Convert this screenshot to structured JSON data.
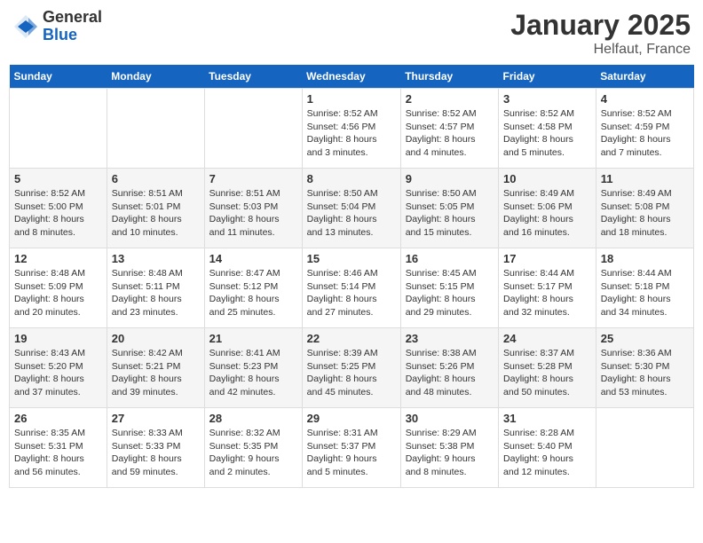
{
  "logo": {
    "general": "General",
    "blue": "Blue"
  },
  "title": "January 2025",
  "subtitle": "Helfaut, France",
  "weekdays": [
    "Sunday",
    "Monday",
    "Tuesday",
    "Wednesday",
    "Thursday",
    "Friday",
    "Saturday"
  ],
  "weeks": [
    [
      {
        "day": "",
        "info": ""
      },
      {
        "day": "",
        "info": ""
      },
      {
        "day": "",
        "info": ""
      },
      {
        "day": "1",
        "info": "Sunrise: 8:52 AM\nSunset: 4:56 PM\nDaylight: 8 hours\nand 3 minutes."
      },
      {
        "day": "2",
        "info": "Sunrise: 8:52 AM\nSunset: 4:57 PM\nDaylight: 8 hours\nand 4 minutes."
      },
      {
        "day": "3",
        "info": "Sunrise: 8:52 AM\nSunset: 4:58 PM\nDaylight: 8 hours\nand 5 minutes."
      },
      {
        "day": "4",
        "info": "Sunrise: 8:52 AM\nSunset: 4:59 PM\nDaylight: 8 hours\nand 7 minutes."
      }
    ],
    [
      {
        "day": "5",
        "info": "Sunrise: 8:52 AM\nSunset: 5:00 PM\nDaylight: 8 hours\nand 8 minutes."
      },
      {
        "day": "6",
        "info": "Sunrise: 8:51 AM\nSunset: 5:01 PM\nDaylight: 8 hours\nand 10 minutes."
      },
      {
        "day": "7",
        "info": "Sunrise: 8:51 AM\nSunset: 5:03 PM\nDaylight: 8 hours\nand 11 minutes."
      },
      {
        "day": "8",
        "info": "Sunrise: 8:50 AM\nSunset: 5:04 PM\nDaylight: 8 hours\nand 13 minutes."
      },
      {
        "day": "9",
        "info": "Sunrise: 8:50 AM\nSunset: 5:05 PM\nDaylight: 8 hours\nand 15 minutes."
      },
      {
        "day": "10",
        "info": "Sunrise: 8:49 AM\nSunset: 5:06 PM\nDaylight: 8 hours\nand 16 minutes."
      },
      {
        "day": "11",
        "info": "Sunrise: 8:49 AM\nSunset: 5:08 PM\nDaylight: 8 hours\nand 18 minutes."
      }
    ],
    [
      {
        "day": "12",
        "info": "Sunrise: 8:48 AM\nSunset: 5:09 PM\nDaylight: 8 hours\nand 20 minutes."
      },
      {
        "day": "13",
        "info": "Sunrise: 8:48 AM\nSunset: 5:11 PM\nDaylight: 8 hours\nand 23 minutes."
      },
      {
        "day": "14",
        "info": "Sunrise: 8:47 AM\nSunset: 5:12 PM\nDaylight: 8 hours\nand 25 minutes."
      },
      {
        "day": "15",
        "info": "Sunrise: 8:46 AM\nSunset: 5:14 PM\nDaylight: 8 hours\nand 27 minutes."
      },
      {
        "day": "16",
        "info": "Sunrise: 8:45 AM\nSunset: 5:15 PM\nDaylight: 8 hours\nand 29 minutes."
      },
      {
        "day": "17",
        "info": "Sunrise: 8:44 AM\nSunset: 5:17 PM\nDaylight: 8 hours\nand 32 minutes."
      },
      {
        "day": "18",
        "info": "Sunrise: 8:44 AM\nSunset: 5:18 PM\nDaylight: 8 hours\nand 34 minutes."
      }
    ],
    [
      {
        "day": "19",
        "info": "Sunrise: 8:43 AM\nSunset: 5:20 PM\nDaylight: 8 hours\nand 37 minutes."
      },
      {
        "day": "20",
        "info": "Sunrise: 8:42 AM\nSunset: 5:21 PM\nDaylight: 8 hours\nand 39 minutes."
      },
      {
        "day": "21",
        "info": "Sunrise: 8:41 AM\nSunset: 5:23 PM\nDaylight: 8 hours\nand 42 minutes."
      },
      {
        "day": "22",
        "info": "Sunrise: 8:39 AM\nSunset: 5:25 PM\nDaylight: 8 hours\nand 45 minutes."
      },
      {
        "day": "23",
        "info": "Sunrise: 8:38 AM\nSunset: 5:26 PM\nDaylight: 8 hours\nand 48 minutes."
      },
      {
        "day": "24",
        "info": "Sunrise: 8:37 AM\nSunset: 5:28 PM\nDaylight: 8 hours\nand 50 minutes."
      },
      {
        "day": "25",
        "info": "Sunrise: 8:36 AM\nSunset: 5:30 PM\nDaylight: 8 hours\nand 53 minutes."
      }
    ],
    [
      {
        "day": "26",
        "info": "Sunrise: 8:35 AM\nSunset: 5:31 PM\nDaylight: 8 hours\nand 56 minutes."
      },
      {
        "day": "27",
        "info": "Sunrise: 8:33 AM\nSunset: 5:33 PM\nDaylight: 8 hours\nand 59 minutes."
      },
      {
        "day": "28",
        "info": "Sunrise: 8:32 AM\nSunset: 5:35 PM\nDaylight: 9 hours\nand 2 minutes."
      },
      {
        "day": "29",
        "info": "Sunrise: 8:31 AM\nSunset: 5:37 PM\nDaylight: 9 hours\nand 5 minutes."
      },
      {
        "day": "30",
        "info": "Sunrise: 8:29 AM\nSunset: 5:38 PM\nDaylight: 9 hours\nand 8 minutes."
      },
      {
        "day": "31",
        "info": "Sunrise: 8:28 AM\nSunset: 5:40 PM\nDaylight: 9 hours\nand 12 minutes."
      },
      {
        "day": "",
        "info": ""
      }
    ]
  ]
}
